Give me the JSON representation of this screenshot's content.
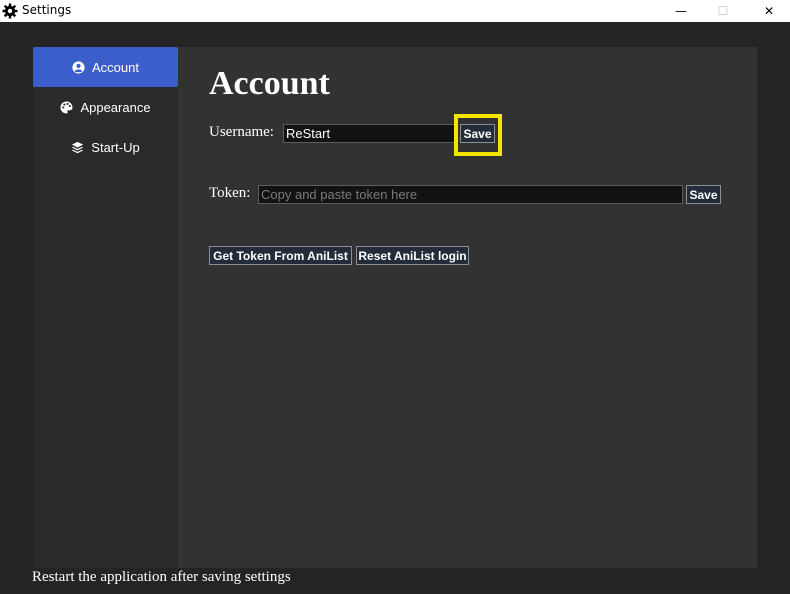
{
  "window": {
    "title": "Settings",
    "controls": {
      "minimize": "—",
      "maximize": "☐",
      "close": "✕"
    }
  },
  "sidebar": {
    "items": [
      {
        "label": "Account",
        "icon": "user-circle-icon",
        "active": true
      },
      {
        "label": "Appearance",
        "icon": "palette-icon",
        "active": false
      },
      {
        "label": "Start-Up",
        "icon": "layers-icon",
        "active": false
      }
    ]
  },
  "account": {
    "heading": "Account",
    "username_label": "Username:",
    "username_value": "ReStart",
    "username_save": "Save",
    "token_label": "Token:",
    "token_placeholder": "Copy and paste token here",
    "token_save": "Save",
    "get_token_label": "Get Token From AniList",
    "reset_login_label": "Reset AniList login"
  },
  "footer": {
    "note": "Restart the application after saving settings"
  },
  "colors": {
    "accent": "#3b5ecb",
    "highlight": "#f5e600",
    "background": "#242424",
    "panel": "#323232"
  }
}
